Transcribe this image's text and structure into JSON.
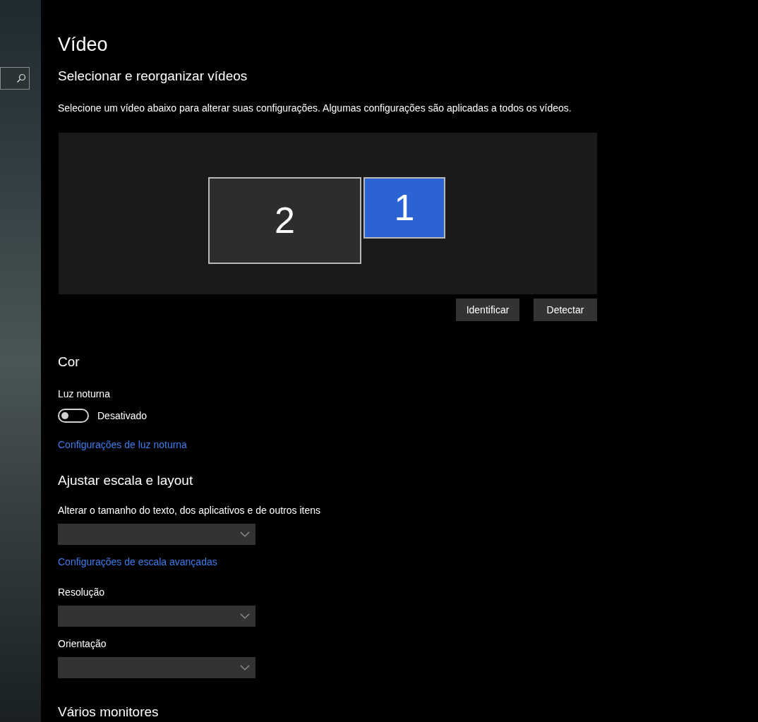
{
  "title": "Vídeo",
  "arrange": {
    "heading": "Selecionar e reorganizar vídeos",
    "description": "Selecione um vídeo abaixo para alterar suas configurações. Algumas configurações são aplicadas a todos os vídeos.",
    "monitors": [
      {
        "number": "2",
        "selected": false
      },
      {
        "number": "1",
        "selected": true
      }
    ],
    "buttons": [
      "Identificar",
      "Detectar"
    ]
  },
  "color": {
    "heading": "Cor",
    "night_light": {
      "label": "Luz noturna",
      "on": false,
      "state_text": "Desativado"
    },
    "link": "Configurações de luz noturna"
  },
  "scale": {
    "heading": "Ajustar escala e layout",
    "size_label": "Alterar o tamanho do texto, dos aplicativos e de outros itens",
    "link": "Configurações de escala avançadas",
    "resolution_label": "Resolução",
    "orientation_label": "Orientação"
  },
  "multiple": {
    "heading": "Vários monitores"
  }
}
